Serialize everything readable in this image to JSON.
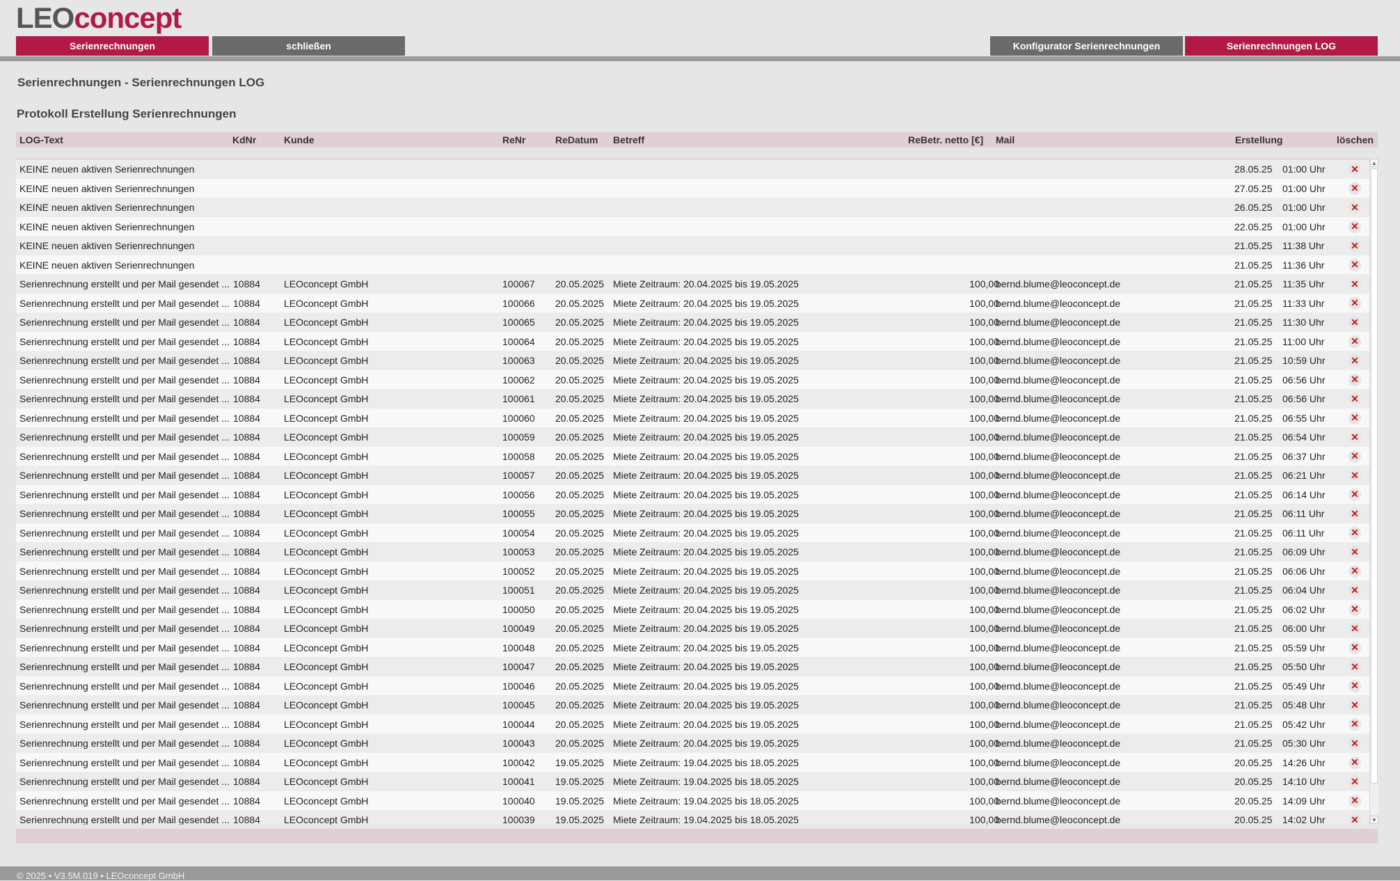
{
  "logo": {
    "part1": "LEO",
    "part2": "concept"
  },
  "nav": {
    "serienrechnungen": "Serienrechnungen",
    "schliessen": "schließen",
    "konfigurator": "Konfigurator Serienrechnungen",
    "log": "Serienrechnungen LOG"
  },
  "breadcrumb": "Serienrechnungen - Serienrechnungen LOG",
  "section_title": "Protokoll Erstellung Serienrechnungen",
  "columns": {
    "log": "LOG-Text",
    "kdnr": "KdNr",
    "kunde": "Kunde",
    "renr": "ReNr",
    "redatum": "ReDatum",
    "betreff": "Betreff",
    "netto": "ReBetr. netto [€]",
    "mail": "Mail",
    "erstellung": "Erstellung",
    "loeschen": "löschen"
  },
  "rows": [
    {
      "log": "KEINE neuen aktiven Serienrechnungen",
      "kd": "",
      "kunde": "",
      "renr": "",
      "redat": "",
      "betreff": "",
      "netto": "",
      "mail": "",
      "date": "28.05.25",
      "time": "01:00 Uhr"
    },
    {
      "log": "KEINE neuen aktiven Serienrechnungen",
      "kd": "",
      "kunde": "",
      "renr": "",
      "redat": "",
      "betreff": "",
      "netto": "",
      "mail": "",
      "date": "27.05.25",
      "time": "01:00 Uhr"
    },
    {
      "log": "KEINE neuen aktiven Serienrechnungen",
      "kd": "",
      "kunde": "",
      "renr": "",
      "redat": "",
      "betreff": "",
      "netto": "",
      "mail": "",
      "date": "26.05.25",
      "time": "01:00 Uhr"
    },
    {
      "log": "KEINE neuen aktiven Serienrechnungen",
      "kd": "",
      "kunde": "",
      "renr": "",
      "redat": "",
      "betreff": "",
      "netto": "",
      "mail": "",
      "date": "22.05.25",
      "time": "01:00 Uhr"
    },
    {
      "log": "KEINE neuen aktiven Serienrechnungen",
      "kd": "",
      "kunde": "",
      "renr": "",
      "redat": "",
      "betreff": "",
      "netto": "",
      "mail": "",
      "date": "21.05.25",
      "time": "11:38 Uhr"
    },
    {
      "log": "KEINE neuen aktiven Serienrechnungen",
      "kd": "",
      "kunde": "",
      "renr": "",
      "redat": "",
      "betreff": "",
      "netto": "",
      "mail": "",
      "date": "21.05.25",
      "time": "11:36 Uhr"
    },
    {
      "log": "Serienrechnung erstellt und per Mail gesendet ...",
      "kd": "10884",
      "kunde": "LEOconcept GmbH",
      "renr": "100067",
      "redat": "20.05.2025",
      "betreff": "Miete Zeitraum: 20.04.2025 bis 19.05.2025",
      "netto": "100,00",
      "mail": "bernd.blume@leoconcept.de",
      "date": "21.05.25",
      "time": "11:35 Uhr"
    },
    {
      "log": "Serienrechnung erstellt und per Mail gesendet ...",
      "kd": "10884",
      "kunde": "LEOconcept GmbH",
      "renr": "100066",
      "redat": "20.05.2025",
      "betreff": "Miete Zeitraum: 20.04.2025 bis 19.05.2025",
      "netto": "100,00",
      "mail": "bernd.blume@leoconcept.de",
      "date": "21.05.25",
      "time": "11:33 Uhr"
    },
    {
      "log": "Serienrechnung erstellt und per Mail gesendet ...",
      "kd": "10884",
      "kunde": "LEOconcept GmbH",
      "renr": "100065",
      "redat": "20.05.2025",
      "betreff": "Miete Zeitraum: 20.04.2025 bis 19.05.2025",
      "netto": "100,00",
      "mail": "bernd.blume@leoconcept.de",
      "date": "21.05.25",
      "time": "11:30 Uhr"
    },
    {
      "log": "Serienrechnung erstellt und per Mail gesendet ...",
      "kd": "10884",
      "kunde": "LEOconcept GmbH",
      "renr": "100064",
      "redat": "20.05.2025",
      "betreff": "Miete Zeitraum: 20.04.2025 bis 19.05.2025",
      "netto": "100,00",
      "mail": "bernd.blume@leoconcept.de",
      "date": "21.05.25",
      "time": "11:00 Uhr"
    },
    {
      "log": "Serienrechnung erstellt und per Mail gesendet ...",
      "kd": "10884",
      "kunde": "LEOconcept GmbH",
      "renr": "100063",
      "redat": "20.05.2025",
      "betreff": "Miete Zeitraum: 20.04.2025 bis 19.05.2025",
      "netto": "100,00",
      "mail": "bernd.blume@leoconcept.de",
      "date": "21.05.25",
      "time": "10:59 Uhr"
    },
    {
      "log": "Serienrechnung erstellt und per Mail gesendet ...",
      "kd": "10884",
      "kunde": "LEOconcept GmbH",
      "renr": "100062",
      "redat": "20.05.2025",
      "betreff": "Miete Zeitraum: 20.04.2025 bis 19.05.2025",
      "netto": "100,00",
      "mail": "bernd.blume@leoconcept.de",
      "date": "21.05.25",
      "time": "06:56 Uhr"
    },
    {
      "log": "Serienrechnung erstellt und per Mail gesendet ...",
      "kd": "10884",
      "kunde": "LEOconcept GmbH",
      "renr": "100061",
      "redat": "20.05.2025",
      "betreff": "Miete Zeitraum: 20.04.2025 bis 19.05.2025",
      "netto": "100,00",
      "mail": "bernd.blume@leoconcept.de",
      "date": "21.05.25",
      "time": "06:56 Uhr"
    },
    {
      "log": "Serienrechnung erstellt und per Mail gesendet ...",
      "kd": "10884",
      "kunde": "LEOconcept GmbH",
      "renr": "100060",
      "redat": "20.05.2025",
      "betreff": "Miete Zeitraum: 20.04.2025 bis 19.05.2025",
      "netto": "100,00",
      "mail": "bernd.blume@leoconcept.de",
      "date": "21.05.25",
      "time": "06:55 Uhr"
    },
    {
      "log": "Serienrechnung erstellt und per Mail gesendet ...",
      "kd": "10884",
      "kunde": "LEOconcept GmbH",
      "renr": "100059",
      "redat": "20.05.2025",
      "betreff": "Miete Zeitraum: 20.04.2025 bis 19.05.2025",
      "netto": "100,00",
      "mail": "bernd.blume@leoconcept.de",
      "date": "21.05.25",
      "time": "06:54 Uhr"
    },
    {
      "log": "Serienrechnung erstellt und per Mail gesendet ...",
      "kd": "10884",
      "kunde": "LEOconcept GmbH",
      "renr": "100058",
      "redat": "20.05.2025",
      "betreff": "Miete Zeitraum: 20.04.2025 bis 19.05.2025",
      "netto": "100,00",
      "mail": "bernd.blume@leoconcept.de",
      "date": "21.05.25",
      "time": "06:37 Uhr"
    },
    {
      "log": "Serienrechnung erstellt und per Mail gesendet ...",
      "kd": "10884",
      "kunde": "LEOconcept GmbH",
      "renr": "100057",
      "redat": "20.05.2025",
      "betreff": "Miete Zeitraum: 20.04.2025 bis 19.05.2025",
      "netto": "100,00",
      "mail": "bernd.blume@leoconcept.de",
      "date": "21.05.25",
      "time": "06:21 Uhr"
    },
    {
      "log": "Serienrechnung erstellt und per Mail gesendet ...",
      "kd": "10884",
      "kunde": "LEOconcept GmbH",
      "renr": "100056",
      "redat": "20.05.2025",
      "betreff": "Miete Zeitraum: 20.04.2025 bis 19.05.2025",
      "netto": "100,00",
      "mail": "bernd.blume@leoconcept.de",
      "date": "21.05.25",
      "time": "06:14 Uhr"
    },
    {
      "log": "Serienrechnung erstellt und per Mail gesendet ...",
      "kd": "10884",
      "kunde": "LEOconcept GmbH",
      "renr": "100055",
      "redat": "20.05.2025",
      "betreff": "Miete Zeitraum: 20.04.2025 bis 19.05.2025",
      "netto": "100,00",
      "mail": "bernd.blume@leoconcept.de",
      "date": "21.05.25",
      "time": "06:11 Uhr"
    },
    {
      "log": "Serienrechnung erstellt und per Mail gesendet ...",
      "kd": "10884",
      "kunde": "LEOconcept GmbH",
      "renr": "100054",
      "redat": "20.05.2025",
      "betreff": "Miete Zeitraum: 20.04.2025 bis 19.05.2025",
      "netto": "100,00",
      "mail": "bernd.blume@leoconcept.de",
      "date": "21.05.25",
      "time": "06:11 Uhr"
    },
    {
      "log": "Serienrechnung erstellt und per Mail gesendet ...",
      "kd": "10884",
      "kunde": "LEOconcept GmbH",
      "renr": "100053",
      "redat": "20.05.2025",
      "betreff": "Miete Zeitraum: 20.04.2025 bis 19.05.2025",
      "netto": "100,00",
      "mail": "bernd.blume@leoconcept.de",
      "date": "21.05.25",
      "time": "06:09 Uhr"
    },
    {
      "log": "Serienrechnung erstellt und per Mail gesendet ...",
      "kd": "10884",
      "kunde": "LEOconcept GmbH",
      "renr": "100052",
      "redat": "20.05.2025",
      "betreff": "Miete Zeitraum: 20.04.2025 bis 19.05.2025",
      "netto": "100,00",
      "mail": "bernd.blume@leoconcept.de",
      "date": "21.05.25",
      "time": "06:06 Uhr"
    },
    {
      "log": "Serienrechnung erstellt und per Mail gesendet ...",
      "kd": "10884",
      "kunde": "LEOconcept GmbH",
      "renr": "100051",
      "redat": "20.05.2025",
      "betreff": "Miete Zeitraum: 20.04.2025 bis 19.05.2025",
      "netto": "100,00",
      "mail": "bernd.blume@leoconcept.de",
      "date": "21.05.25",
      "time": "06:04 Uhr"
    },
    {
      "log": "Serienrechnung erstellt und per Mail gesendet ...",
      "kd": "10884",
      "kunde": "LEOconcept GmbH",
      "renr": "100050",
      "redat": "20.05.2025",
      "betreff": "Miete Zeitraum: 20.04.2025 bis 19.05.2025",
      "netto": "100,00",
      "mail": "bernd.blume@leoconcept.de",
      "date": "21.05.25",
      "time": "06:02 Uhr"
    },
    {
      "log": "Serienrechnung erstellt und per Mail gesendet ...",
      "kd": "10884",
      "kunde": "LEOconcept GmbH",
      "renr": "100049",
      "redat": "20.05.2025",
      "betreff": "Miete Zeitraum: 20.04.2025 bis 19.05.2025",
      "netto": "100,00",
      "mail": "bernd.blume@leoconcept.de",
      "date": "21.05.25",
      "time": "06:00 Uhr"
    },
    {
      "log": "Serienrechnung erstellt und per Mail gesendet ...",
      "kd": "10884",
      "kunde": "LEOconcept GmbH",
      "renr": "100048",
      "redat": "20.05.2025",
      "betreff": "Miete Zeitraum: 20.04.2025 bis 19.05.2025",
      "netto": "100,00",
      "mail": "bernd.blume@leoconcept.de",
      "date": "21.05.25",
      "time": "05:59 Uhr"
    },
    {
      "log": "Serienrechnung erstellt und per Mail gesendet ...",
      "kd": "10884",
      "kunde": "LEOconcept GmbH",
      "renr": "100047",
      "redat": "20.05.2025",
      "betreff": "Miete Zeitraum: 20.04.2025 bis 19.05.2025",
      "netto": "100,00",
      "mail": "bernd.blume@leoconcept.de",
      "date": "21.05.25",
      "time": "05:50 Uhr"
    },
    {
      "log": "Serienrechnung erstellt und per Mail gesendet ...",
      "kd": "10884",
      "kunde": "LEOconcept GmbH",
      "renr": "100046",
      "redat": "20.05.2025",
      "betreff": "Miete Zeitraum: 20.04.2025 bis 19.05.2025",
      "netto": "100,00",
      "mail": "bernd.blume@leoconcept.de",
      "date": "21.05.25",
      "time": "05:49 Uhr"
    },
    {
      "log": "Serienrechnung erstellt und per Mail gesendet ...",
      "kd": "10884",
      "kunde": "LEOconcept GmbH",
      "renr": "100045",
      "redat": "20.05.2025",
      "betreff": "Miete Zeitraum: 20.04.2025 bis 19.05.2025",
      "netto": "100,00",
      "mail": "bernd.blume@leoconcept.de",
      "date": "21.05.25",
      "time": "05:48 Uhr"
    },
    {
      "log": "Serienrechnung erstellt und per Mail gesendet ...",
      "kd": "10884",
      "kunde": "LEOconcept GmbH",
      "renr": "100044",
      "redat": "20.05.2025",
      "betreff": "Miete Zeitraum: 20.04.2025 bis 19.05.2025",
      "netto": "100,00",
      "mail": "bernd.blume@leoconcept.de",
      "date": "21.05.25",
      "time": "05:42 Uhr"
    },
    {
      "log": "Serienrechnung erstellt und per Mail gesendet ...",
      "kd": "10884",
      "kunde": "LEOconcept GmbH",
      "renr": "100043",
      "redat": "20.05.2025",
      "betreff": "Miete Zeitraum: 20.04.2025 bis 19.05.2025",
      "netto": "100,00",
      "mail": "bernd.blume@leoconcept.de",
      "date": "21.05.25",
      "time": "05:30 Uhr"
    },
    {
      "log": "Serienrechnung erstellt und per Mail gesendet ...",
      "kd": "10884",
      "kunde": "LEOconcept GmbH",
      "renr": "100042",
      "redat": "19.05.2025",
      "betreff": "Miete Zeitraum: 19.04.2025 bis 18.05.2025",
      "netto": "100,00",
      "mail": "bernd.blume@leoconcept.de",
      "date": "20.05.25",
      "time": "14:26 Uhr"
    },
    {
      "log": "Serienrechnung erstellt und per Mail gesendet ...",
      "kd": "10884",
      "kunde": "LEOconcept GmbH",
      "renr": "100041",
      "redat": "19.05.2025",
      "betreff": "Miete Zeitraum: 19.04.2025 bis 18.05.2025",
      "netto": "100,00",
      "mail": "bernd.blume@leoconcept.de",
      "date": "20.05.25",
      "time": "14:10 Uhr"
    },
    {
      "log": "Serienrechnung erstellt und per Mail gesendet ...",
      "kd": "10884",
      "kunde": "LEOconcept GmbH",
      "renr": "100040",
      "redat": "19.05.2025",
      "betreff": "Miete Zeitraum: 19.04.2025 bis 18.05.2025",
      "netto": "100,00",
      "mail": "bernd.blume@leoconcept.de",
      "date": "20.05.25",
      "time": "14:09 Uhr"
    },
    {
      "log": "Serienrechnung erstellt und per Mail gesendet ...",
      "kd": "10884",
      "kunde": "LEOconcept GmbH",
      "renr": "100039",
      "redat": "19.05.2025",
      "betreff": "Miete Zeitraum: 19.04.2025 bis 18.05.2025",
      "netto": "100,00",
      "mail": "bernd.blume@leoconcept.de",
      "date": "20.05.25",
      "time": "14:02 Uhr"
    }
  ],
  "delete_symbol": "✕",
  "footer": "© 2025 • V3.5M.019 • LEOconcept GmbH",
  "colors": {
    "accent": "#b21a45",
    "nav_grey": "#6a6a6a",
    "header_bg": "#e0cfd5",
    "delete": "#d01515"
  }
}
